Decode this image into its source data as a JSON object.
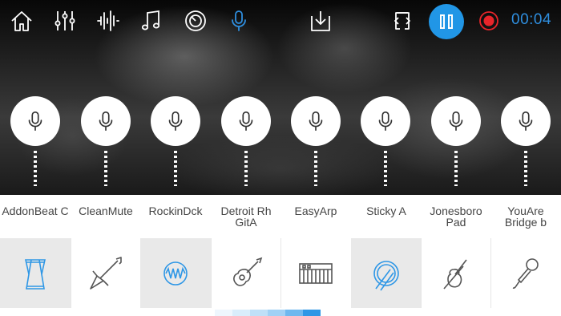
{
  "toolbar": {
    "icons": [
      "home-icon",
      "mixer-icon",
      "waveform-icon",
      "music-notes-icon",
      "knob-icon",
      "microphone-icon",
      "download-icon",
      "loop-icon"
    ],
    "timer": "00:04",
    "accent_color": "#2196e6",
    "record_color": "#e8252a"
  },
  "tracks": [
    {
      "label": "AddonBeat C",
      "instrument": "drum-icon",
      "selected": true
    },
    {
      "label": "CleanMute",
      "instrument": "electric-guitar-icon",
      "selected": false
    },
    {
      "label": "RockinDck",
      "instrument": "waveform-synth-icon",
      "selected": true
    },
    {
      "label": "Detroit Rh GitA",
      "instrument": "acoustic-guitar-icon",
      "selected": false
    },
    {
      "label": "EasyArp",
      "instrument": "keyboard-icon",
      "selected": false
    },
    {
      "label": "Sticky A",
      "instrument": "snare-drum-icon",
      "selected": true
    },
    {
      "label": "Jonesboro Pad",
      "instrument": "violin-icon",
      "selected": false
    },
    {
      "label": "YouAre Bridge b",
      "instrument": "microphone-icon",
      "selected": false
    }
  ],
  "progress_colors": [
    "#eef6fd",
    "#d9edfb",
    "#bfe0f8",
    "#a1d1f5",
    "#6fb8ef",
    "#2f97e6"
  ]
}
